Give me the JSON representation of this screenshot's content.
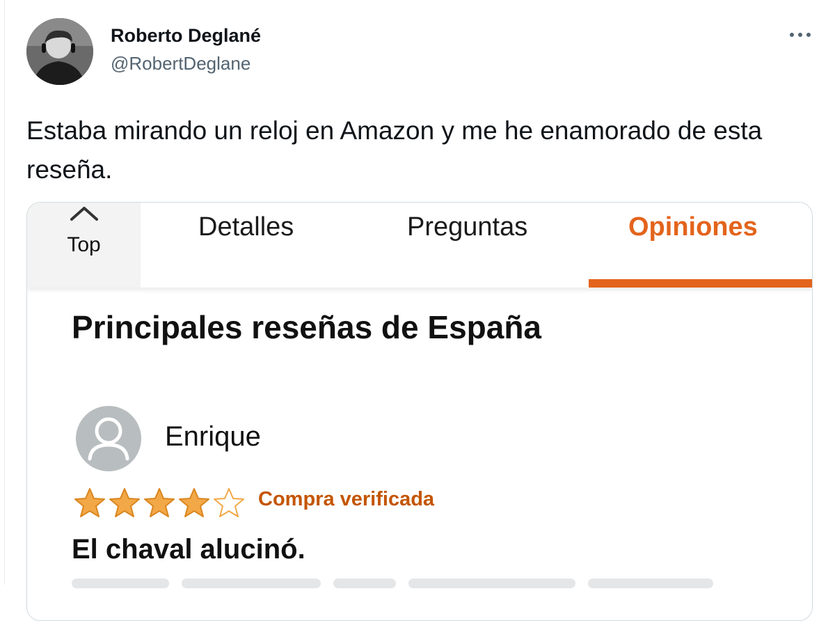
{
  "author": {
    "display_name": "Roberto Deglané",
    "handle": "@RobertDeglane"
  },
  "tweet": {
    "text": "Estaba mirando un reloj en Amazon y me he enamorado de esta reseña."
  },
  "embedded": {
    "tabs": {
      "top_label": "Top",
      "detalles": "Detalles",
      "preguntas": "Preguntas",
      "opiniones": "Opiniones",
      "active": "Opiniones"
    },
    "section_title": "Principales reseñas de España",
    "review": {
      "reviewer": "Enrique",
      "rating": 4,
      "rating_max": 5,
      "verified_label": "Compra verificada",
      "title": "El chaval alucinó."
    },
    "colors": {
      "accent": "#e3641c",
      "star": "#f3a847",
      "verified": "#c45500"
    }
  }
}
